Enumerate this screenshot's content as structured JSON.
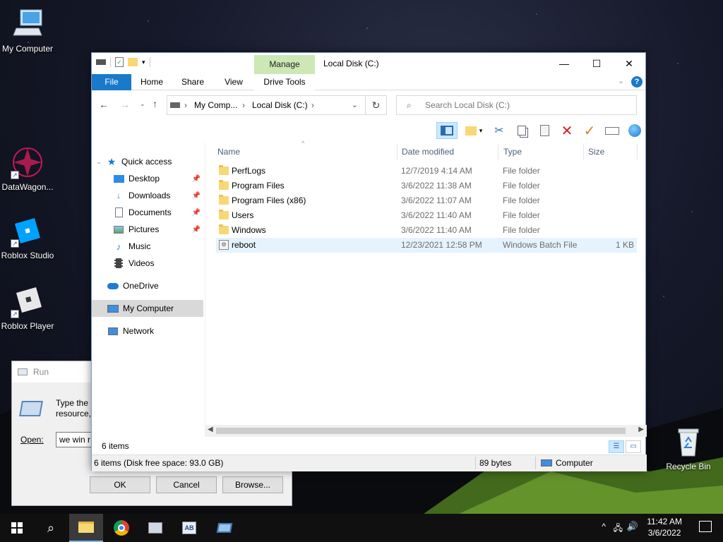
{
  "desktop": {
    "icons": [
      {
        "label": "My Computer",
        "icon": "computer-icon"
      },
      {
        "label": "DataWagon...",
        "icon": "datawagon-icon"
      },
      {
        "label": "Roblox Studio",
        "icon": "roblox-studio-icon"
      },
      {
        "label": "Roblox Player",
        "icon": "roblox-player-icon"
      },
      {
        "label": "Recycle Bin",
        "icon": "recycle-bin-icon"
      }
    ]
  },
  "run_dialog": {
    "title": "Run",
    "prompt_line1": "Type the n",
    "prompt_line2": "resource,",
    "open_label": "Open:",
    "open_value": "we win r",
    "ok_label": "OK",
    "cancel_label": "Cancel",
    "browse_label": "Browse..."
  },
  "explorer": {
    "title": "Local Disk (C:)",
    "manage_tab": "Manage",
    "tabs": {
      "file": "File",
      "home": "Home",
      "share": "Share",
      "view": "View",
      "drive_tools": "Drive Tools"
    },
    "breadcrumb": [
      "My Comp...",
      "Local Disk (C:)"
    ],
    "search_placeholder": "Search Local Disk (C:)",
    "nav": {
      "quick_access": "Quick access",
      "desktop": "Desktop",
      "downloads": "Downloads",
      "documents": "Documents",
      "pictures": "Pictures",
      "music": "Music",
      "videos": "Videos",
      "onedrive": "OneDrive",
      "my_computer": "My Computer",
      "network": "Network"
    },
    "columns": {
      "name": "Name",
      "date": "Date modified",
      "type": "Type",
      "size": "Size"
    },
    "files": [
      {
        "name": "PerfLogs",
        "date": "12/7/2019 4:14 AM",
        "type": "File folder",
        "size": "",
        "kind": "folder"
      },
      {
        "name": "Program Files",
        "date": "3/6/2022 11:38 AM",
        "type": "File folder",
        "size": "",
        "kind": "folder"
      },
      {
        "name": "Program Files (x86)",
        "date": "3/6/2022 11:07 AM",
        "type": "File folder",
        "size": "",
        "kind": "folder"
      },
      {
        "name": "Users",
        "date": "3/6/2022 11:40 AM",
        "type": "File folder",
        "size": "",
        "kind": "folder"
      },
      {
        "name": "Windows",
        "date": "3/6/2022 11:40 AM",
        "type": "File folder",
        "size": "",
        "kind": "folder"
      },
      {
        "name": "reboot",
        "date": "12/23/2021 12:58 PM",
        "type": "Windows Batch File",
        "size": "1 KB",
        "kind": "batch"
      }
    ],
    "item_count": "6 items",
    "details_status": "6 items (Disk free space: 93.0 GB)",
    "details_size": "89 bytes",
    "details_location": "Computer"
  },
  "taskbar": {
    "time": "11:42 AM",
    "date": "3/6/2022"
  },
  "colors": {
    "file_tab": "#1979ca",
    "manage_tab": "#cce8b5",
    "selection": "#e5f3ff",
    "nav_selected": "#cce8ff"
  }
}
